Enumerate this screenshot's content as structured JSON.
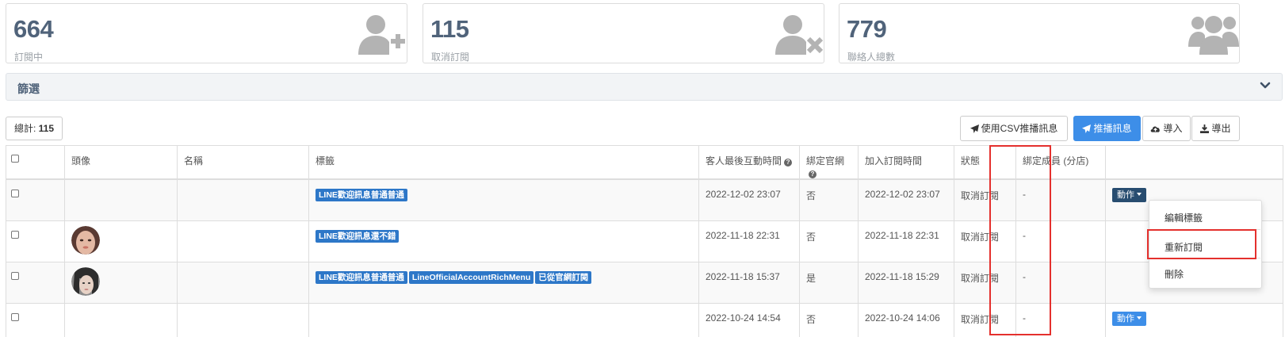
{
  "stats": [
    {
      "value": "664",
      "label": "訂閱中",
      "icon": "user-plus-icon"
    },
    {
      "value": "115",
      "label": "取消訂閱",
      "icon": "user-times-icon"
    },
    {
      "value": "779",
      "label": "聯絡人總數",
      "icon": "users-icon"
    }
  ],
  "filter": {
    "label": "篩選"
  },
  "toolbar": {
    "total_label": "總計: ",
    "total_value": "115",
    "csv_button": "使用CSV推播訊息",
    "broadcast_button": "推播訊息",
    "import_button": "導入",
    "export_button": "導出"
  },
  "table": {
    "headers": {
      "avatar": "頭像",
      "name": "名稱",
      "tags": "標籤",
      "last_interaction": "客人最後互動時間",
      "bound": "綁定官網",
      "joined": "加入訂閱時間",
      "status": "狀態",
      "member": "綁定成員 (分店)"
    },
    "rows": [
      {
        "tags": [
          "LINE歡迎訊息普通普通"
        ],
        "last_interaction": "2022-12-02 23:07",
        "bound": "否",
        "joined": "2022-12-02 23:07",
        "status": "取消訂閱",
        "member": "-",
        "action": "動作"
      },
      {
        "tags": [
          "LINE歡迎訊息還不錯"
        ],
        "last_interaction": "2022-11-18 22:31",
        "bound": "否",
        "joined": "2022-11-18 22:31",
        "status": "取消訂閱",
        "member": "-"
      },
      {
        "tags": [
          "LINE歡迎訊息普通普通",
          "LineOfficialAccountRichMenu",
          "已從官網訂閱"
        ],
        "last_interaction": "2022-11-18 15:37",
        "bound": "是",
        "joined": "2022-11-18 15:29",
        "status": "取消訂閱",
        "member": "-"
      },
      {
        "tags": [],
        "last_interaction": "2022-10-24 14:54",
        "bound": "否",
        "joined": "2022-10-24 14:06",
        "status": "取消訂閱",
        "member": "-",
        "action": "動作"
      }
    ]
  },
  "dropdown": {
    "items": [
      "編輯標籤",
      "重新訂閱",
      "刪除"
    ]
  },
  "colors": {
    "stat_number": "#50637a",
    "tag_blue": "#2d77c8",
    "primary": "#3d8ee8",
    "action_dark": "#284d70",
    "highlight_red": "#e4302d"
  }
}
